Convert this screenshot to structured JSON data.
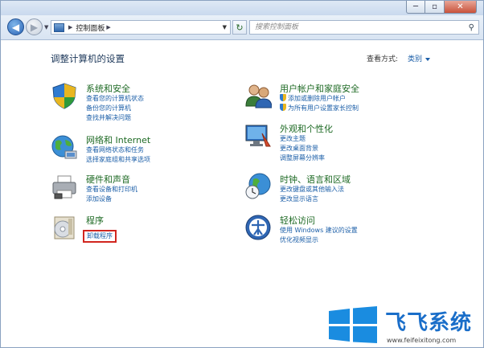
{
  "window": {
    "caption_buttons": [
      "─",
      "▫",
      "✕"
    ]
  },
  "navbar": {
    "breadcrumb": "控制面板",
    "search_placeholder": "搜索控制面板"
  },
  "content": {
    "heading": "调整计算机的设置",
    "view_by_label": "查看方式:",
    "view_by_value": "类别"
  },
  "categories": [
    {
      "title": "系统和安全",
      "icon": "security-shield-icon",
      "links": [
        "查看您的计算机状态",
        "备份您的计算机",
        "查找并解决问题"
      ]
    },
    {
      "title": "网络和 Internet",
      "icon": "network-globe-icon",
      "links": [
        "查看网络状态和任务",
        "选择家庭组和共享选项"
      ]
    },
    {
      "title": "硬件和声音",
      "icon": "printer-icon",
      "links": [
        "查看设备和打印机",
        "添加设备"
      ]
    },
    {
      "title": "程序",
      "icon": "programs-icon",
      "links": [
        "卸载程序"
      ]
    },
    {
      "title": "用户帐户和家庭安全",
      "icon": "users-icon",
      "links": [
        "添加或删除用户帐户",
        "为所有用户设置家长控制"
      ]
    },
    {
      "title": "外观和个性化",
      "icon": "monitor-icon",
      "links": [
        "更改主题",
        "更改桌面背景",
        "调整屏幕分辨率"
      ]
    },
    {
      "title": "时钟、语言和区域",
      "icon": "clock-globe-icon",
      "links": [
        "更改键盘或其他输入法",
        "更改显示语言"
      ]
    },
    {
      "title": "轻松访问",
      "icon": "ease-of-access-icon",
      "links": [
        "使用 Windows 建议的设置",
        "优化视频显示"
      ]
    }
  ],
  "watermark": {
    "brand": "飞飞系统",
    "url": "www.feifeixitong.com"
  }
}
